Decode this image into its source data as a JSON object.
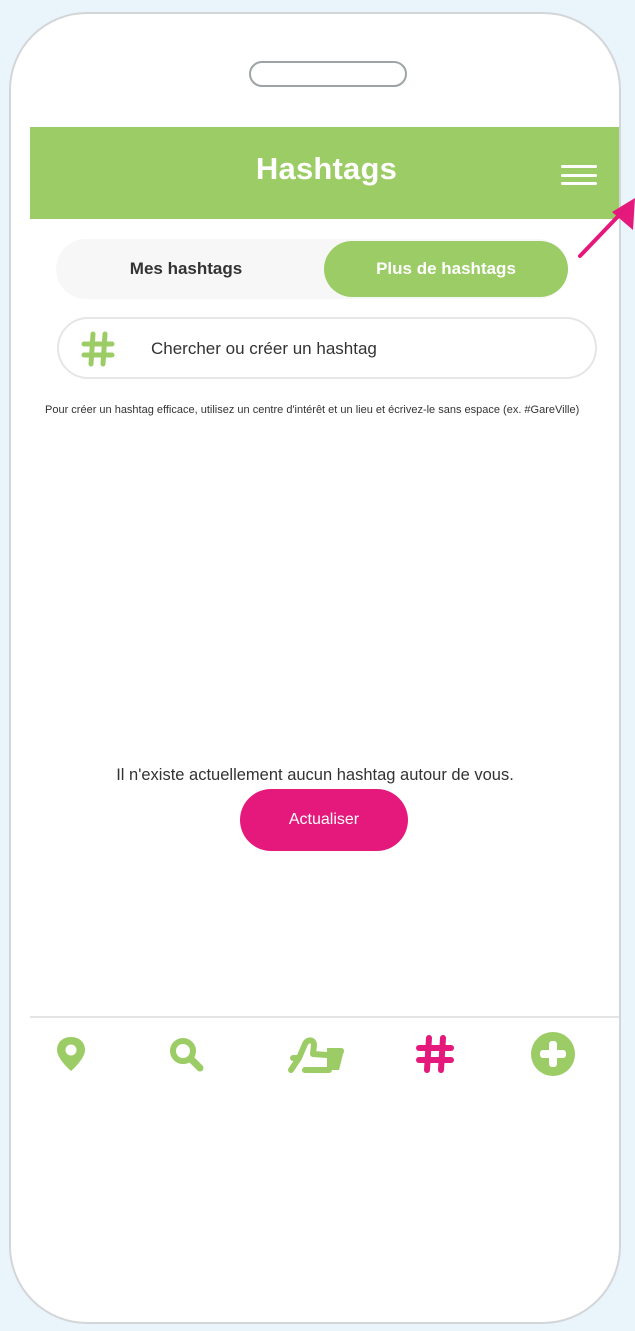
{
  "header": {
    "title": "Hashtags"
  },
  "tabs": [
    {
      "label": "Mes hashtags",
      "active": false
    },
    {
      "label": "Plus de hashtags",
      "active": true
    }
  ],
  "search": {
    "placeholder": "Chercher ou créer un hashtag",
    "value": ""
  },
  "hint": "Pour créer un hashtag efficace, utilisez un centre d'intérêt et un lieu et écrivez-le sans espace (ex. #GareVille)",
  "empty": {
    "message": "Il n'existe actuellement aucun hashtag autour de vous.",
    "button_label": "Actualiser"
  },
  "bottom_nav": [
    {
      "icon": "map-pin-icon",
      "active": false
    },
    {
      "icon": "search-icon",
      "active": false
    },
    {
      "icon": "thumbs-up-icon",
      "active": false
    },
    {
      "icon": "hashtag-icon",
      "active": true
    },
    {
      "icon": "plus-circle-icon",
      "active": false
    }
  ],
  "colors": {
    "accent": "#9ccc65",
    "highlight": "#e5197b",
    "background": "#eaf4fb"
  }
}
